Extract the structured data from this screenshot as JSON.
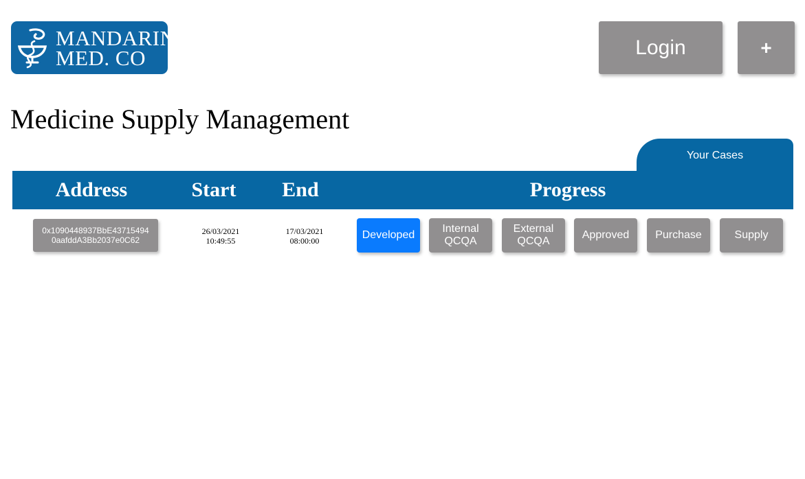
{
  "logo": {
    "line1": "MANDARIN",
    "line2": "MED. CO",
    "icon": "bowl-of-hygieia-icon",
    "brand_color": "#0f67a5"
  },
  "header": {
    "login_label": "Login",
    "add_label": "+"
  },
  "page_title": "Medicine Supply Management",
  "tabs": {
    "your_cases_label": "Your Cases"
  },
  "table": {
    "columns": [
      "Address",
      "Start",
      "End",
      "Progress"
    ],
    "rows": [
      {
        "address_line1": "0x1090448937BbE43715494",
        "address_line2": "0aafddA3Bb2037e0C62",
        "start_date": "26/03/2021",
        "start_time": "10:49:55",
        "end_date": "17/03/2021",
        "end_time": "08:00:00",
        "progress": [
          {
            "label": "Developed",
            "active": true
          },
          {
            "label": "Internal\nQCQA",
            "active": false
          },
          {
            "label": "External\nQCQA",
            "active": false
          },
          {
            "label": "Approved",
            "active": false
          },
          {
            "label": "Purchase",
            "active": false
          },
          {
            "label": "Supply",
            "active": false
          }
        ]
      }
    ]
  },
  "colors": {
    "header_blue": "#0767a3",
    "button_gray": "#918f90",
    "active_step": "#0a7bfe"
  }
}
